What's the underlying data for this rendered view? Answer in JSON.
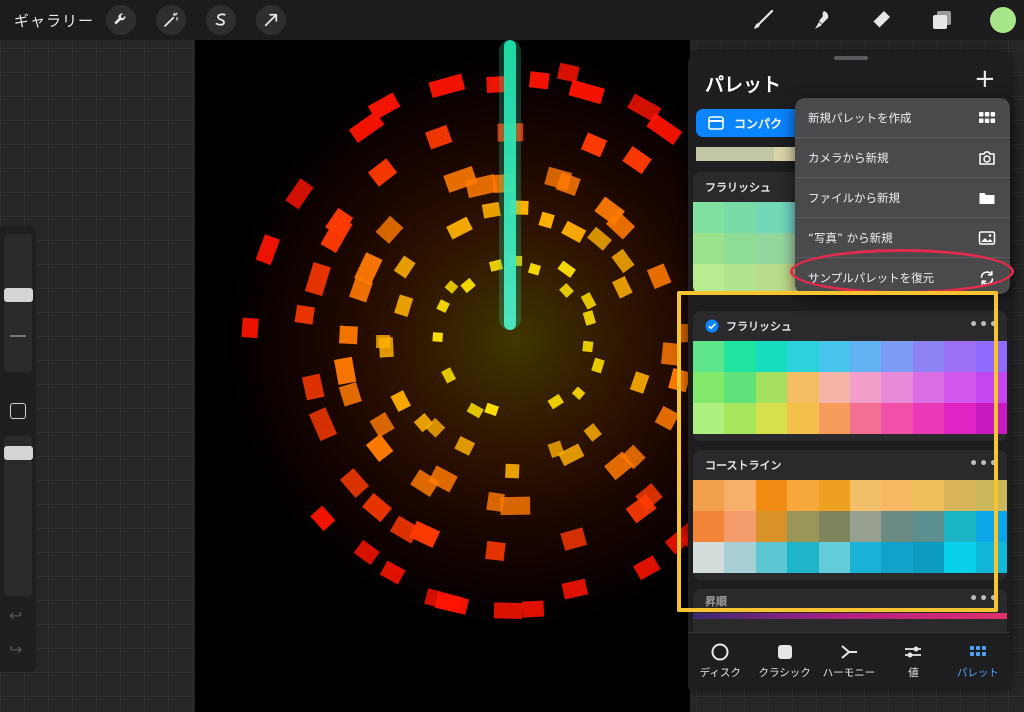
{
  "toolbar": {
    "gallery_label": "ギャラリー",
    "left_tools": [
      "wrench-icon",
      "magic-wand-icon",
      "selection-icon",
      "transform-arrow-icon"
    ],
    "right_tools": [
      "brush-icon",
      "smudge-icon",
      "eraser-icon",
      "layers-icon"
    ],
    "current_color": "#a7e58a"
  },
  "sidebar": {
    "undo_icon": "undo-icon",
    "redo_icon": "redo-icon",
    "modify_button_icon": "square-icon"
  },
  "palette_panel": {
    "title": "パレット",
    "add_icon": "plus-icon",
    "compact_button_label": "コンパク",
    "mini_row_colors": [
      "#c2c6a5",
      "#d9d5ab",
      "#e9e2b9",
      "#d8cfa5"
    ],
    "top_palette": {
      "name": "フラリッシュ",
      "colors": [
        "#7fe0a0",
        "#78dba8",
        "#72d8b8",
        "#74d6c8",
        "#7ccfd0",
        "#86c8d8",
        "#90c0e0",
        "#9cb8e6",
        "#a8b0e8",
        "#b4a8e8",
        "#9be28c",
        "#8fdc96",
        "#92d89e",
        "#a0d4a6",
        "#b0ceae",
        "#c0c8b6",
        "#d0c2be",
        "#dcbcc2",
        "#e6b6c6",
        "#eeb0c8",
        "#b8ec90",
        "#b0e48e",
        "#b8dc8c",
        "#c4d48a",
        "#d0cc88",
        "#dcc486",
        "#e6bc86",
        "#eeb486",
        "#f2ac88",
        "#f4a48a"
      ]
    },
    "palettes": [
      {
        "name": "フラリッシュ",
        "is_default": true,
        "colors": [
          "#5ee58c",
          "#1fe3a0",
          "#18dcc0",
          "#2bd2dc",
          "#47c5ec",
          "#63b3f3",
          "#7b9bf5",
          "#8d83f5",
          "#9d6ff2",
          "#8f6cff",
          "#82e96a",
          "#5fe27a",
          "#a4e05e",
          "#f3bd62",
          "#f4b4a8",
          "#f29ec8",
          "#e88ad8",
          "#dc6ee4",
          "#d056ec",
          "#c446ee",
          "#aef07e",
          "#a6e65c",
          "#d6e04c",
          "#f4c04c",
          "#f59c5c",
          "#f37092",
          "#f050a8",
          "#ea38b8",
          "#e024c4",
          "#c818c0"
        ]
      },
      {
        "name": "コーストライン",
        "is_default": false,
        "colors": [
          "#f3a04c",
          "#f6b06a",
          "#f08c14",
          "#f6a83a",
          "#eea020",
          "#f2c068",
          "#f6b862",
          "#eebe5a",
          "#d8b45a",
          "#c8b85a",
          "#f28438",
          "#f49c6c",
          "#d89228",
          "#9a9658",
          "#80845c",
          "#98a090",
          "#6a8a82",
          "#5c9090",
          "#1ab4c4",
          "#0aa6e6",
          "#d4dcdc",
          "#a8d0d4",
          "#5ec6d2",
          "#20b4c8",
          "#64ccd8",
          "#1cb2d6",
          "#10a2c8",
          "#0c9cc0",
          "#08d0ec",
          "#12b6d6"
        ]
      },
      {
        "name": "昇順",
        "is_default": false,
        "colors": []
      }
    ],
    "more_icon": "ellipsis-icon"
  },
  "menu": {
    "items": [
      {
        "label": "新規パレットを作成",
        "icon": "grid-icon"
      },
      {
        "label": "カメラから新規",
        "icon": "camera-icon"
      },
      {
        "label": "ファイルから新規",
        "icon": "folder-icon"
      },
      {
        "label": "“写真” から新規",
        "icon": "photo-icon"
      },
      {
        "label": "サンプルパレットを復元",
        "icon": "restore-icon"
      }
    ]
  },
  "tabs": [
    {
      "label": "ディスク",
      "icon": "disc-icon",
      "active": false
    },
    {
      "label": "クラシック",
      "icon": "classic-square-icon",
      "active": false
    },
    {
      "label": "ハーモニー",
      "icon": "harmony-icon",
      "active": false
    },
    {
      "label": "値",
      "icon": "sliders-icon",
      "active": false
    },
    {
      "label": "パレット",
      "icon": "palette-grid-icon",
      "active": true
    }
  ],
  "annotation_colors": {
    "highlight_ellipse": "#e22b4c",
    "highlight_box": "#f7c331"
  }
}
